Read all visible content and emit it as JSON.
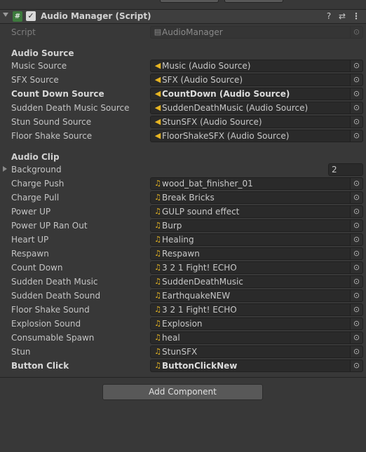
{
  "component": {
    "title": "Audio Manager (Script)",
    "script_icon": "#",
    "enabled_check": "✓",
    "help_icon": "?",
    "presets_icon": "⇄",
    "menu_icon": "⋮"
  },
  "script_row": {
    "label": "Script",
    "value": "AudioManager"
  },
  "audio_source": {
    "title": "Audio Source",
    "rows": [
      {
        "label": "Music Source",
        "value": "Music (Audio Source)"
      },
      {
        "label": "SFX Source",
        "value": "SFX (Audio Source)"
      },
      {
        "label": "Count Down Source",
        "value": "CountDown (Audio Source)"
      },
      {
        "label": "Sudden Death Music Source",
        "value": "SuddenDeathMusic (Audio Source)"
      },
      {
        "label": "Stun Sound Source",
        "value": "StunSFX (Audio Source)"
      },
      {
        "label": "Floor Shake Source",
        "value": "FloorShakeSFX (Audio Source)"
      }
    ]
  },
  "audio_clip": {
    "title": "Audio Clip",
    "background": {
      "label": "Background",
      "count": "2"
    },
    "rows": [
      {
        "label": "Charge Push",
        "value": "wood_bat_finisher_01"
      },
      {
        "label": "Charge Pull",
        "value": "Break Bricks"
      },
      {
        "label": "Power UP",
        "value": "GULP sound effect"
      },
      {
        "label": "Power UP Ran Out",
        "value": "Burp"
      },
      {
        "label": "Heart UP",
        "value": "Healing"
      },
      {
        "label": "Respawn",
        "value": "Respawn"
      },
      {
        "label": "Count Down",
        "value": "3 2 1 Fight! ECHO"
      },
      {
        "label": "Sudden Death Music",
        "value": "SuddenDeathMusic"
      },
      {
        "label": "Sudden Death Sound",
        "value": "EarthquakeNEW"
      },
      {
        "label": "Floor Shake Sound",
        "value": "3 2 1 Fight! ECHO"
      },
      {
        "label": "Explosion Sound",
        "value": "Explosion"
      },
      {
        "label": "Consumable Spawn",
        "value": "heal"
      },
      {
        "label": "Stun",
        "value": "StunSFX"
      },
      {
        "label": "Button Click",
        "value": "ButtonClickNew"
      }
    ]
  },
  "add_component_label": "Add Component",
  "icons": {
    "audio_source": "speaker-icon",
    "audio_clip": "note-icon",
    "picker": "object-picker-icon",
    "script": "script-file-icon"
  },
  "colors": {
    "panel": "#383838",
    "field": "#2a2a2a",
    "accent_icon": "#e6b422"
  }
}
